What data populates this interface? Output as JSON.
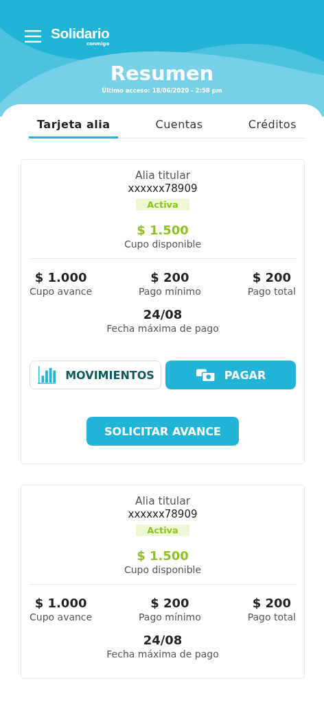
{
  "header": {
    "logo": "Solidario",
    "logo_sub": "conmigo",
    "title": "Resumen",
    "last_access": "Último acceso: 18/06/2020 - 2:58 pm"
  },
  "tabs": [
    {
      "label": "Tarjeta alia",
      "selected": true
    },
    {
      "label": "Cuentas",
      "selected": false
    },
    {
      "label": "Créditos",
      "selected": false
    }
  ],
  "cards": [
    {
      "title": "Alia titular",
      "number": "xxxxxx78909",
      "status": "Activa",
      "available": "$ 1.500",
      "available_label": "Cupo disponible",
      "stats": [
        {
          "value": "$ 1.000",
          "label": "Cupo avance"
        },
        {
          "value": "$ 200",
          "label": "Pago mínimo"
        },
        {
          "value": "$ 200",
          "label": "Pago total"
        }
      ],
      "due": "24/08",
      "due_label": "Fecha máxima de pago",
      "buttons": [
        {
          "kind": "outline",
          "label": "MOVIMIENTOS"
        },
        {
          "kind": "filled",
          "label": "PAGAR"
        }
      ],
      "main_button": "SOLICITAR AVANCE"
    },
    {
      "title": "Alia titular",
      "number": "xxxxxx78909",
      "status": "Activa",
      "available": "$ 1.500",
      "available_label": "Cupo disponible",
      "stats": [
        {
          "value": "$ 1.000",
          "label": "Cupo avance"
        },
        {
          "value": "$ 200",
          "label": "Pago mínimo"
        },
        {
          "value": "$ 200",
          "label": "Pago total"
        }
      ],
      "due": "24/08",
      "due_label": "Fecha máxima de pago"
    }
  ]
}
